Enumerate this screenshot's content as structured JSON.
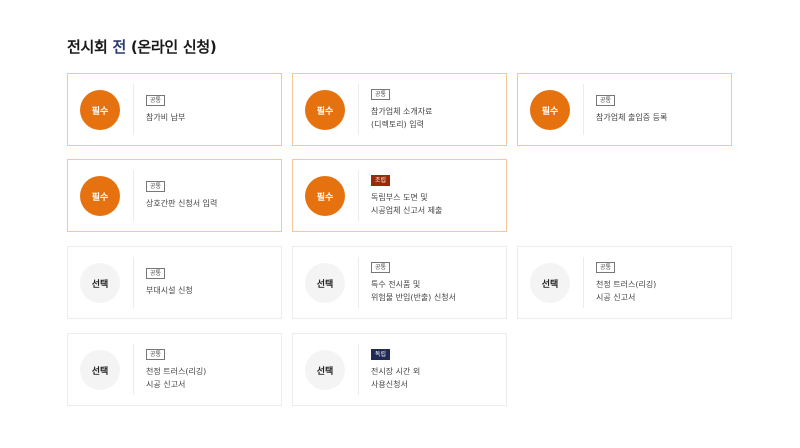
{
  "page": {
    "title_prefix": "전시회 ",
    "title_accent": "전",
    "title_suffix": " (온라인 신청)"
  },
  "colors": {
    "required_circle": "#e5720f",
    "required_border": "#f2c79a",
    "optional_circle": "#f4f4f4",
    "badge_brown": "#9b2a06",
    "badge_navy": "#1f2a55",
    "title_accent": "#2b3a6b"
  },
  "cards": [
    {
      "status": "필수",
      "badge": "공통",
      "lines": [
        "참가비 납부"
      ]
    },
    {
      "status": "필수",
      "badge": "공통",
      "lines": [
        "참가업체 소개자료",
        "(디렉토리) 입력"
      ]
    },
    {
      "status": "필수",
      "badge": "공통",
      "lines": [
        "참가업체 출입증 등록"
      ]
    },
    {
      "status": "필수",
      "badge": "공통",
      "lines": [
        "상호간판 신청서 입력"
      ]
    },
    {
      "status": "필수",
      "badge": "조립",
      "lines": [
        "독립부스 도면 및",
        "시공업체 신고서 제출"
      ]
    },
    {
      "status": "선택",
      "badge": "공통",
      "lines": [
        "부대시설 신청"
      ]
    },
    {
      "status": "선택",
      "badge": "공통",
      "lines": [
        "특수 전시품 및",
        "위험물 반입(반출) 신청서"
      ]
    },
    {
      "status": "선택",
      "badge": "공통",
      "lines": [
        "천정 트러스(리깅)",
        "시공 신고서"
      ]
    },
    {
      "status": "선택",
      "badge": "공통",
      "lines": [
        "천정 트러스(리깅)",
        "시공 신고서"
      ]
    },
    {
      "status": "선택",
      "badge": "독립",
      "lines": [
        "전시장 시간 외",
        "사용신청서"
      ]
    }
  ]
}
